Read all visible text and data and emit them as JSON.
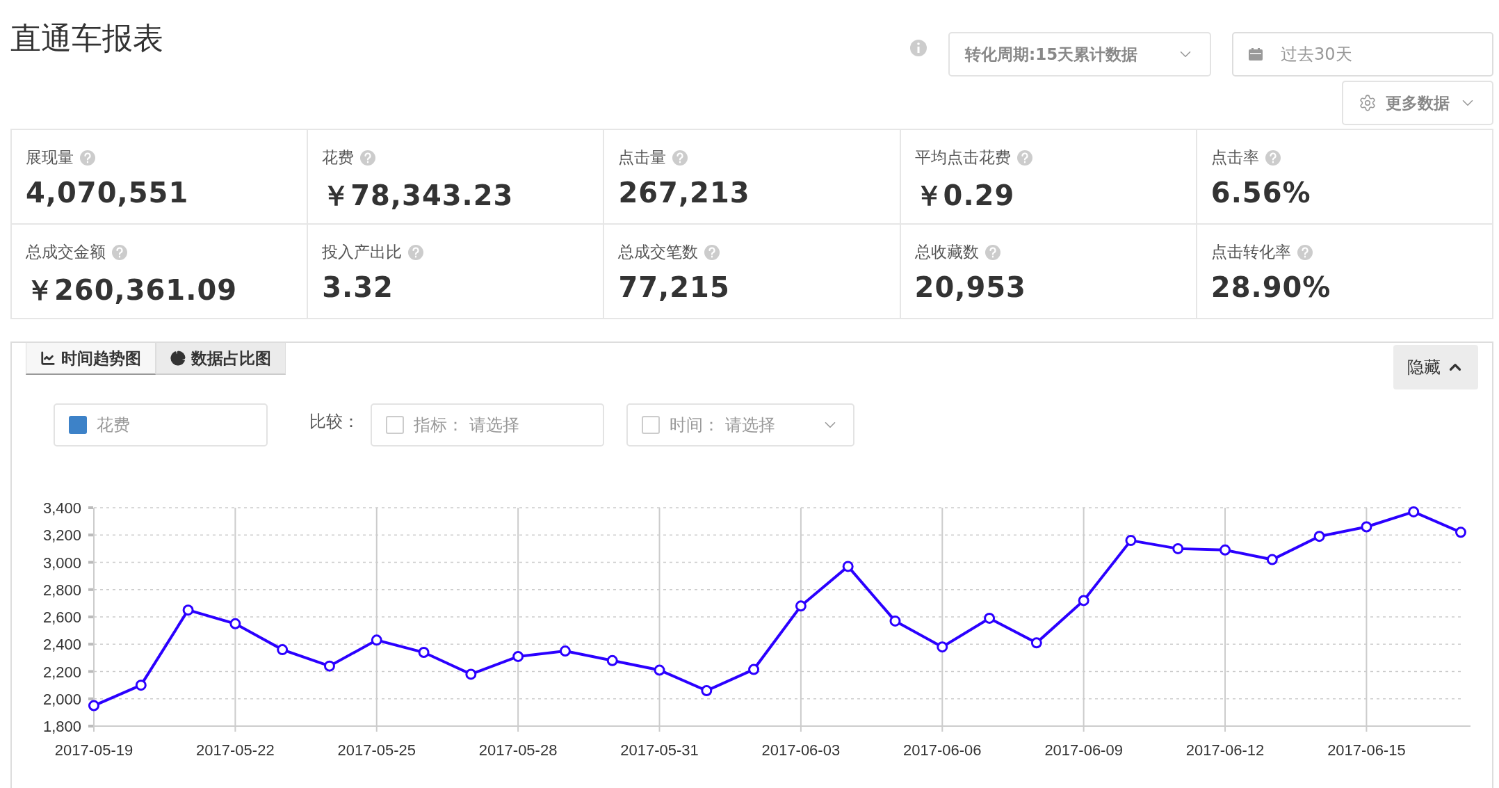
{
  "page_title": "直通车报表",
  "controls": {
    "conversion_period": "转化周期:15天累计数据",
    "date_range": "过去30天",
    "more_data": "更多数据"
  },
  "metrics": [
    {
      "label": "展现量",
      "value": "4,070,551"
    },
    {
      "label": "花费",
      "value": "￥78,343.23"
    },
    {
      "label": "点击量",
      "value": "267,213"
    },
    {
      "label": "平均点击花费",
      "value": "￥0.29"
    },
    {
      "label": "点击率",
      "value": "6.56%"
    },
    {
      "label": "总成交金额",
      "value": "￥260,361.09"
    },
    {
      "label": "投入产出比",
      "value": "3.32"
    },
    {
      "label": "总成交笔数",
      "value": "77,215"
    },
    {
      "label": "总收藏数",
      "value": "20,953"
    },
    {
      "label": "点击转化率",
      "value": "28.90%"
    }
  ],
  "chart_panel": {
    "tabs": [
      {
        "label": "时间趋势图",
        "kind": "line",
        "selected": true
      },
      {
        "label": "数据占比图",
        "kind": "pie",
        "selected": false
      }
    ],
    "hide_button": "隐藏",
    "legend": {
      "color": "#3d82c8"
    },
    "compare_label": "比较：",
    "compare_filters": [
      {
        "label": "指标：",
        "placeholder": "请选择",
        "checked": false,
        "kind": "plain"
      },
      {
        "label": "时间：",
        "placeholder": "请选择",
        "checked": false,
        "kind": "dropdown"
      }
    ],
    "chart_data": {
      "type": "line",
      "categories": [
        "2017-05-19",
        null,
        null,
        "2017-05-22",
        null,
        null,
        "2017-05-25",
        null,
        null,
        "2017-05-28",
        null,
        null,
        "2017-05-31",
        null,
        null,
        "2017-06-03",
        null,
        null,
        "2017-06-06",
        null,
        null,
        "2017-06-09",
        null,
        null,
        "2017-06-12",
        null,
        null,
        "2017-06-15",
        null,
        null
      ],
      "grid": true,
      "series": [
        {
          "name": "花费",
          "color": "#2b00ff",
          "marker": "circle",
          "values": [
            1950,
            2100,
            2650,
            2550,
            2360,
            2240,
            2430,
            2340,
            2180,
            2310,
            2350,
            2280,
            2210,
            2060,
            2215,
            2680,
            2970,
            2570,
            2380,
            2590,
            2410,
            2720,
            3160,
            3100,
            3090,
            3020,
            3190,
            3260,
            3370,
            3220
          ]
        }
      ],
      "ylim": [
        1800,
        3400
      ],
      "yticks": [
        {
          "value": 1800,
          "label": "1,800"
        },
        {
          "value": 2000,
          "label": "2,000"
        },
        {
          "value": 2200,
          "label": "2,200"
        },
        {
          "value": 2400,
          "label": "2,400"
        },
        {
          "value": 2600,
          "label": "2,600"
        },
        {
          "value": 2800,
          "label": "2,800"
        },
        {
          "value": 3000,
          "label": "3,000"
        },
        {
          "value": 3200,
          "label": "3,200"
        },
        {
          "value": 3400,
          "label": "3,400"
        }
      ]
    }
  }
}
